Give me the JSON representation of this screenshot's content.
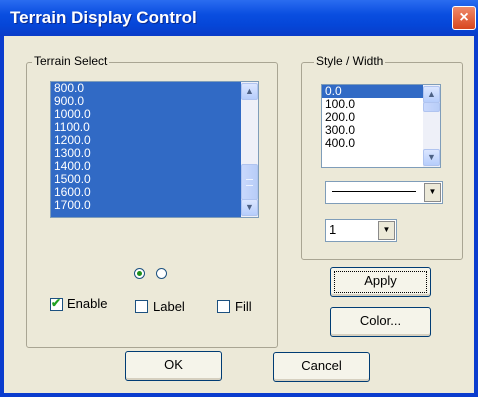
{
  "window": {
    "title": "Terrain Display Control",
    "close_icon": "×"
  },
  "terrain_select": {
    "label": "Terrain Select",
    "items": [
      "800.0",
      "900.0",
      "1000.0",
      "1100.0",
      "1200.0",
      "1300.0",
      "1400.0",
      "1500.0",
      "1600.0",
      "1700.0"
    ]
  },
  "style_width": {
    "label": "Style / Width",
    "items": [
      "0.0",
      "100.0",
      "200.0",
      "300.0",
      "400.0"
    ],
    "selected_item": "0.0",
    "line_style_selected": "solid",
    "width_value": "1"
  },
  "radio": {
    "selected_index": 0
  },
  "checkboxes": {
    "enable": {
      "label": "Enable",
      "checked": true
    },
    "label": {
      "label": "Label",
      "checked": false
    },
    "fill": {
      "label": "Fill",
      "checked": false
    }
  },
  "buttons": {
    "apply": "Apply",
    "color": "Color...",
    "ok": "OK",
    "cancel": "Cancel"
  },
  "icons": {
    "scroll_up": "▲",
    "scroll_down": "▼",
    "dropdown": "▼"
  },
  "colors": {
    "selection": "#316ac5",
    "dialog_bg": "#ece9d8",
    "title_bar": "#0a4ee0"
  }
}
